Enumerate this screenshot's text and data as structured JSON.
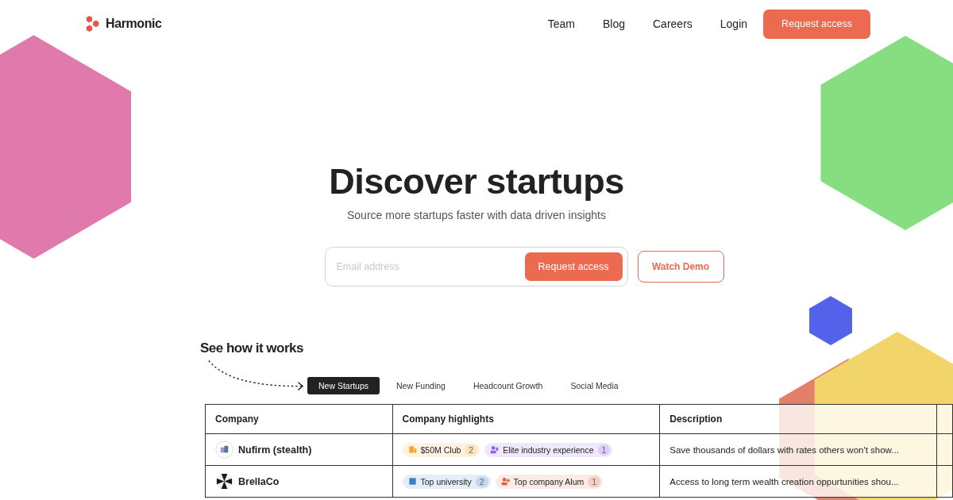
{
  "brand": {
    "name": "Harmonic"
  },
  "nav": [
    {
      "label": "Team"
    },
    {
      "label": "Blog"
    },
    {
      "label": "Careers"
    },
    {
      "label": "Login"
    }
  ],
  "nav_cta": "Request access",
  "hero": {
    "title": "Discover startups",
    "subtitle": "Source more startups faster with data driven insights"
  },
  "signup": {
    "placeholder": "Email address",
    "button": "Request access",
    "secondary": "Watch Demo"
  },
  "demo": {
    "heading": "See how it works",
    "tabs": [
      {
        "label": "New Startups",
        "selected": true
      },
      {
        "label": "New Funding",
        "selected": false
      },
      {
        "label": "Headcount Growth",
        "selected": false
      },
      {
        "label": "Social Media",
        "selected": false
      }
    ]
  },
  "table": {
    "columns": [
      "Company",
      "Company highlights",
      "Description"
    ],
    "rows": [
      {
        "company": "Nufirm (stealth)",
        "kind": "building",
        "highlights": [
          {
            "kind": "building",
            "label": "$50M Club",
            "count": "2",
            "color": "#f5a623"
          },
          {
            "kind": "person-check",
            "label": "Elite industry experience",
            "count": "1",
            "color": "#8b5cf6"
          }
        ],
        "description": "Save thousands of dollars with rates others won't show..."
      },
      {
        "company": "BrellaCo",
        "kind": "pinwheel",
        "highlights": [
          {
            "kind": "school",
            "label": "Top university",
            "count": "2",
            "color": "#3b82c4"
          },
          {
            "kind": "person-plus",
            "label": "Top company Alum",
            "count": "1",
            "color": "#e0603a"
          }
        ],
        "description": "Access to long term wealth creation oppurtunities shou..."
      }
    ]
  }
}
